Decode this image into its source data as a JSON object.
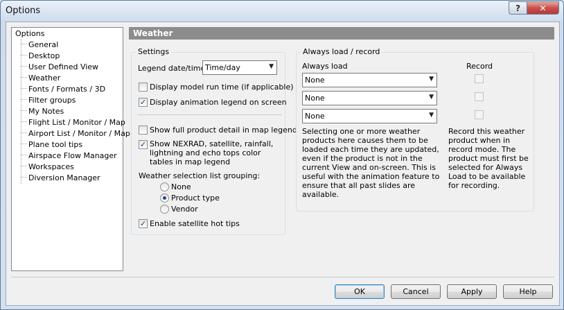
{
  "window": {
    "title": "Options",
    "help_glyph": "?",
    "close_glyph": "✕"
  },
  "tree": {
    "root": "Options",
    "items": [
      "General",
      "Desktop",
      "User Defined View",
      "Weather",
      "Fonts / Formats / 3D",
      "Filter groups",
      "My Notes",
      "Flight List / Monitor / Map",
      "Airport List / Monitor / Map",
      "Plane tool tips",
      "Airspace Flow Manager",
      "Workspaces",
      "Diversion Manager"
    ]
  },
  "section": {
    "title": "Weather"
  },
  "settings": {
    "group_title": "Settings",
    "legend_label": "Legend date/time:",
    "legend_value": "Time/day",
    "display_model_run": {
      "label": "Display model run time (if applicable)",
      "checked": false
    },
    "display_animation": {
      "label": "Display animation legend on screen",
      "checked": true
    },
    "show_full_detail": {
      "label": "Show full product detail in map legend",
      "checked": false
    },
    "show_nexrad": {
      "label": "Show NEXRAD, satellite, rainfall, lightning and echo tops color tables in map legend",
      "checked": true
    },
    "grouping_label": "Weather selection list grouping:",
    "grouping_options": [
      "None",
      "Product type",
      "Vendor"
    ],
    "grouping_selected": "Product type",
    "satellite_tips": {
      "label": "Enable satellite hot tips",
      "checked": true
    }
  },
  "always_load": {
    "group_title": "Always load / record",
    "col_load": "Always load",
    "col_record": "Record",
    "rows": [
      {
        "value": "None",
        "record": false
      },
      {
        "value": "None",
        "record": false
      },
      {
        "value": "None",
        "record": false
      }
    ],
    "load_help": "Selecting one or more weather products here causes them to be loaded each time they are updated, even if the product is not in the current View and on-screen. This is useful with the animation feature to ensure that all past slides are available.",
    "record_help": "Record this weather product when in record mode.  The product must first be selected for Always Load to be available for recording."
  },
  "buttons": {
    "ok": "OK",
    "cancel": "Cancel",
    "apply": "Apply",
    "help": "Help"
  }
}
